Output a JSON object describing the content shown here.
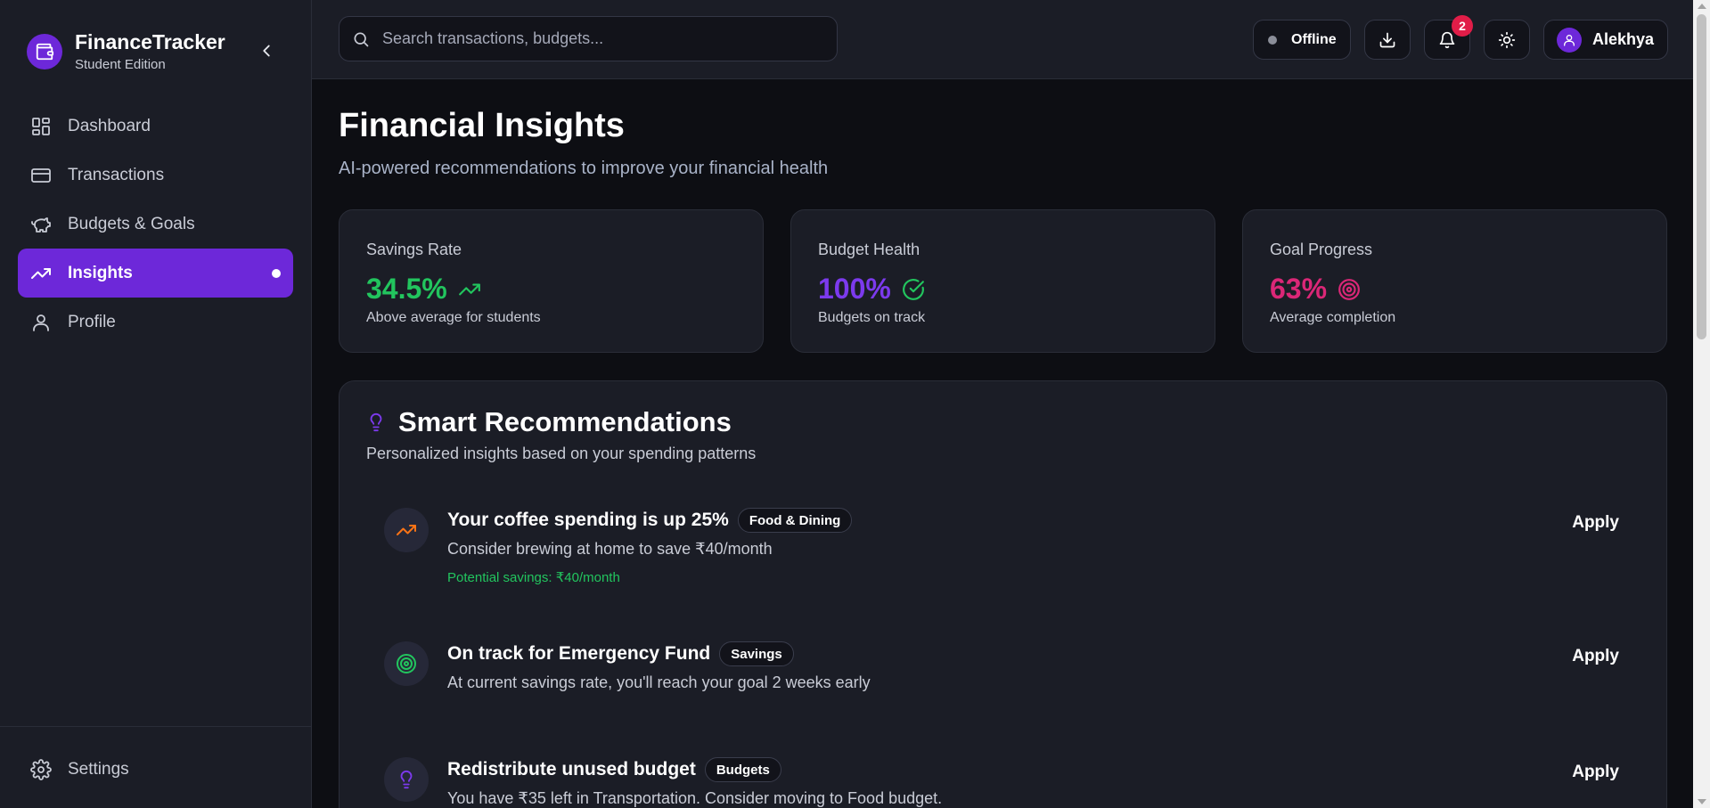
{
  "brand": {
    "title": "FinanceTracker",
    "subtitle": "Student Edition"
  },
  "nav": {
    "items": [
      {
        "label": "Dashboard",
        "icon": "grid-icon"
      },
      {
        "label": "Transactions",
        "icon": "credit-card-icon"
      },
      {
        "label": "Budgets & Goals",
        "icon": "piggy-bank-icon"
      },
      {
        "label": "Insights",
        "icon": "trending-up-icon",
        "active": true
      },
      {
        "label": "Profile",
        "icon": "user-icon"
      }
    ],
    "settings_label": "Settings"
  },
  "topbar": {
    "search_placeholder": "Search transactions, budgets...",
    "status": "Offline",
    "notification_count": "2",
    "user_name": "Alekhya"
  },
  "page": {
    "title": "Financial Insights",
    "subtitle": "AI-powered recommendations to improve your financial health"
  },
  "stats": [
    {
      "label": "Savings Rate",
      "value": "34.5%",
      "note": "Above average for students",
      "color": "#22c55e",
      "icon": "trending-up-icon"
    },
    {
      "label": "Budget Health",
      "value": "100%",
      "note": "Budgets on track",
      "color": "#7c3aed",
      "icon": "check-circle-icon"
    },
    {
      "label": "Goal Progress",
      "value": "63%",
      "note": "Average completion",
      "color": "#db2777",
      "icon": "target-icon"
    }
  ],
  "recommendations": {
    "title": "Smart Recommendations",
    "subtitle": "Personalized insights based on your spending patterns",
    "items": [
      {
        "title": "Your coffee spending is up 25%",
        "tag": "Food & Dining",
        "desc": "Consider brewing at home to save ₹40/month",
        "savings": "Potential savings: ₹40/month",
        "action": "Apply"
      },
      {
        "title": "On track for Emergency Fund",
        "tag": "Savings",
        "desc": "At current savings rate, you'll reach your goal 2 weeks early",
        "action": "Apply"
      },
      {
        "title": "Redistribute unused budget",
        "tag": "Budgets",
        "desc": "You have ₹35 left in Transportation. Consider moving to Food budget.",
        "action": "Apply"
      }
    ]
  },
  "colors": {
    "accent": "#6d28d9",
    "success": "#22c55e",
    "warning": "#f97316",
    "pink": "#db2777",
    "badge": "#e11d48"
  }
}
